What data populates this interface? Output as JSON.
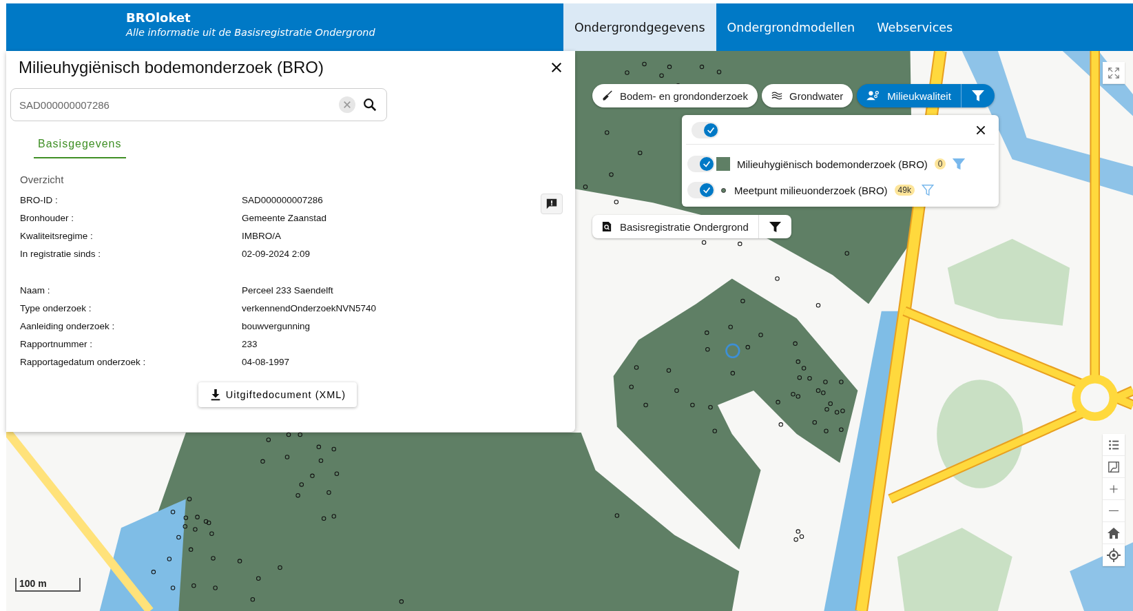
{
  "header": {
    "title": "BROloket",
    "subtitle": "Alle informatie uit de Basisregistratie Ondergrond"
  },
  "nav_tabs": [
    {
      "label": "Ondergrondgegevens",
      "selected": true
    },
    {
      "label": "Ondergrondmodellen",
      "selected": false
    },
    {
      "label": "Webservices",
      "selected": false
    }
  ],
  "panel": {
    "title": "Milieuhygiënisch bodemonderzoek (BRO)",
    "search": {
      "value": "SAD000000007286"
    },
    "tabs": [
      {
        "label": "Basisgegevens",
        "selected": true
      }
    ],
    "section": "Overzicht",
    "groups": [
      [
        {
          "label": "BRO-ID :",
          "value": "SAD000000007286"
        },
        {
          "label": "Bronhouder :",
          "value": "Gemeente Zaanstad"
        },
        {
          "label": "Kwaliteitsregime :",
          "value": "IMBRO/A"
        },
        {
          "label": "In registratie sinds :",
          "value": "02-09-2024 2:09"
        }
      ],
      [
        {
          "label": "Naam :",
          "value": "Perceel 233 Saendelft"
        },
        {
          "label": "Type onderzoek :",
          "value": "verkennendOnderzoekNVN5740"
        },
        {
          "label": "Aanleiding onderzoek :",
          "value": "bouwvergunning"
        },
        {
          "label": "Rapportnummer :",
          "value": "233"
        },
        {
          "label": "Rapportagedatum onderzoek :",
          "value": "04-08-1997"
        }
      ]
    ],
    "download_button": "Uitgiftedocument (XML)"
  },
  "layer_buttons": [
    {
      "label": "Bodem- en grondonderzoek",
      "kind": "shovel",
      "selected": false
    },
    {
      "label": "Grondwater",
      "kind": "waves",
      "selected": false
    },
    {
      "label": "Milieukwaliteit",
      "kind": "people",
      "selected": true
    }
  ],
  "layer_popover": {
    "all_checked": true,
    "layers": [
      {
        "name": "Milieuhygiënisch bodemonderzoek (BRO)",
        "kind": "area",
        "checked": true,
        "count": "0",
        "filter_active": true
      },
      {
        "name": "Meetpunt milieuonderzoek (BRO)",
        "kind": "point",
        "checked": true,
        "count": "49k",
        "filter_active": false
      }
    ]
  },
  "base_layer": {
    "label": "Basisregistratie Ondergrond"
  },
  "scale": "100 m"
}
